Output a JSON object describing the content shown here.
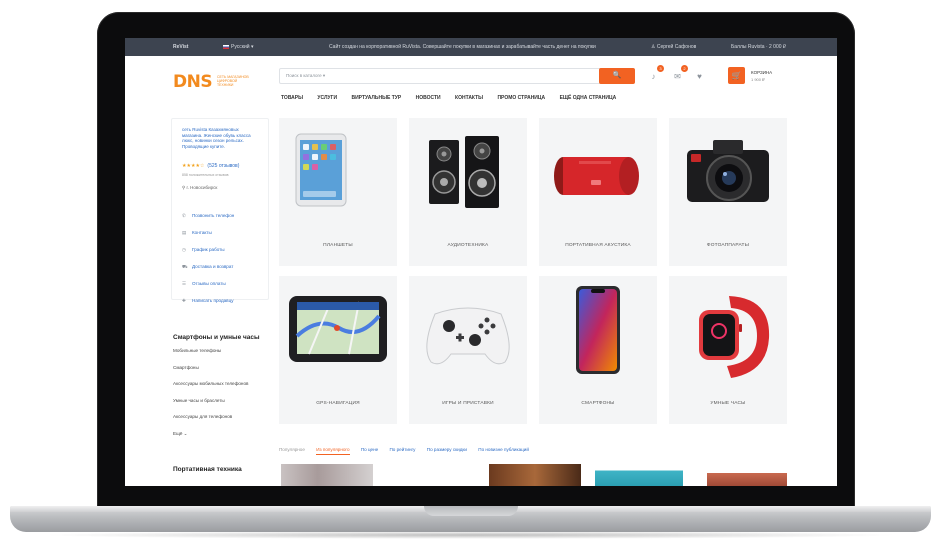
{
  "topbar": {
    "city_brand": "ReVist",
    "language": "Русский",
    "notice": "Сайт создан на корпоративной RuVista. Совершайте покупки в магазинах и зарабатывайте часть денег на покупки",
    "user": "Сергей Сафонов",
    "bonus": "Баллы Ruvista · 2 000 ₽"
  },
  "header": {
    "logo": "DNS",
    "logo_sub": "СЕТЬ МАГАЗИНОВ ЦИФРОВОЙ ТЕХНИКИ",
    "search_category": "Поиск в каталоге ▾",
    "search_button": "🔍",
    "badges": {
      "notifications": "3",
      "messages": "2"
    },
    "cart_label": "КОРЗИНА",
    "cart_sum": "1 900 ₽"
  },
  "nav": [
    "ТОВАРЫ",
    "УСЛУГИ",
    "ВИРТУАЛЬНЫЕ ТУР",
    "НОВОСТИ",
    "КОНТАКТЫ",
    "ПРОМО СТРАНИЦА",
    "ЕЩЁ ОДНА СТРАНИЦА"
  ],
  "sidebar": {
    "promo_text": "сеть Ruvista Казахмяновых магазина. Женские обувь класса люкс, новинки сезон рельсах. Проводящие купите.",
    "rating": "★★★★☆",
    "rating_score": "(525 отзывов)",
    "reviews": "858 положительных отзывов",
    "geo": "г. Новосибирск",
    "links": [
      {
        "icon": "phone-icon",
        "glyph": "✆",
        "label": "Позвонить телефон"
      },
      {
        "icon": "contacts-icon",
        "glyph": "▤",
        "label": "Контакты"
      },
      {
        "icon": "clock-icon",
        "glyph": "◷",
        "label": "График работы"
      },
      {
        "icon": "truck-icon",
        "glyph": "⛟",
        "label": "Доставка и возврат"
      },
      {
        "icon": "reviews-icon",
        "glyph": "☰",
        "label": "Отзывы оплаты"
      },
      {
        "icon": "gift-icon",
        "glyph": "✚",
        "label": "Написать продавцу"
      }
    ],
    "section1_title": "Смартфоны и умные часы",
    "section1_items": [
      "Мобильные телефоны",
      "Смартфоны",
      "Аксессуары мобильных телефонов",
      "Умные часы и браслеты",
      "Аксессуары для телефонов",
      "Ещё ⌄"
    ],
    "section2_title": "Портативная техника"
  },
  "tiles": [
    {
      "label": "ПЛАНШЕТЫ"
    },
    {
      "label": "АУДИОТЕХНИКА"
    },
    {
      "label": "ПОРТАТИВНАЯ АКУСТИКА"
    },
    {
      "label": "ФОТОАППАРАТЫ"
    },
    {
      "label": "GPS-НАВИГАЦИЯ"
    },
    {
      "label": "ИГРЫ И ПРИСТАВКИ"
    },
    {
      "label": "СМАРТФОНЫ"
    },
    {
      "label": "УМНЫЕ ЧАСЫ"
    }
  ],
  "tabs": [
    {
      "label": "Популярное",
      "state": "muted"
    },
    {
      "label": "Из популярного",
      "state": "active"
    },
    {
      "label": "По цене",
      "state": ""
    },
    {
      "label": "По рейтингу",
      "state": ""
    },
    {
      "label": "По размеру скидки",
      "state": ""
    },
    {
      "label": "По новизне публикаций",
      "state": ""
    }
  ],
  "colors": {
    "accent": "#f26222",
    "link": "#2c6bc4",
    "topbar": "#3d4450",
    "logo": "#f28a1e"
  }
}
